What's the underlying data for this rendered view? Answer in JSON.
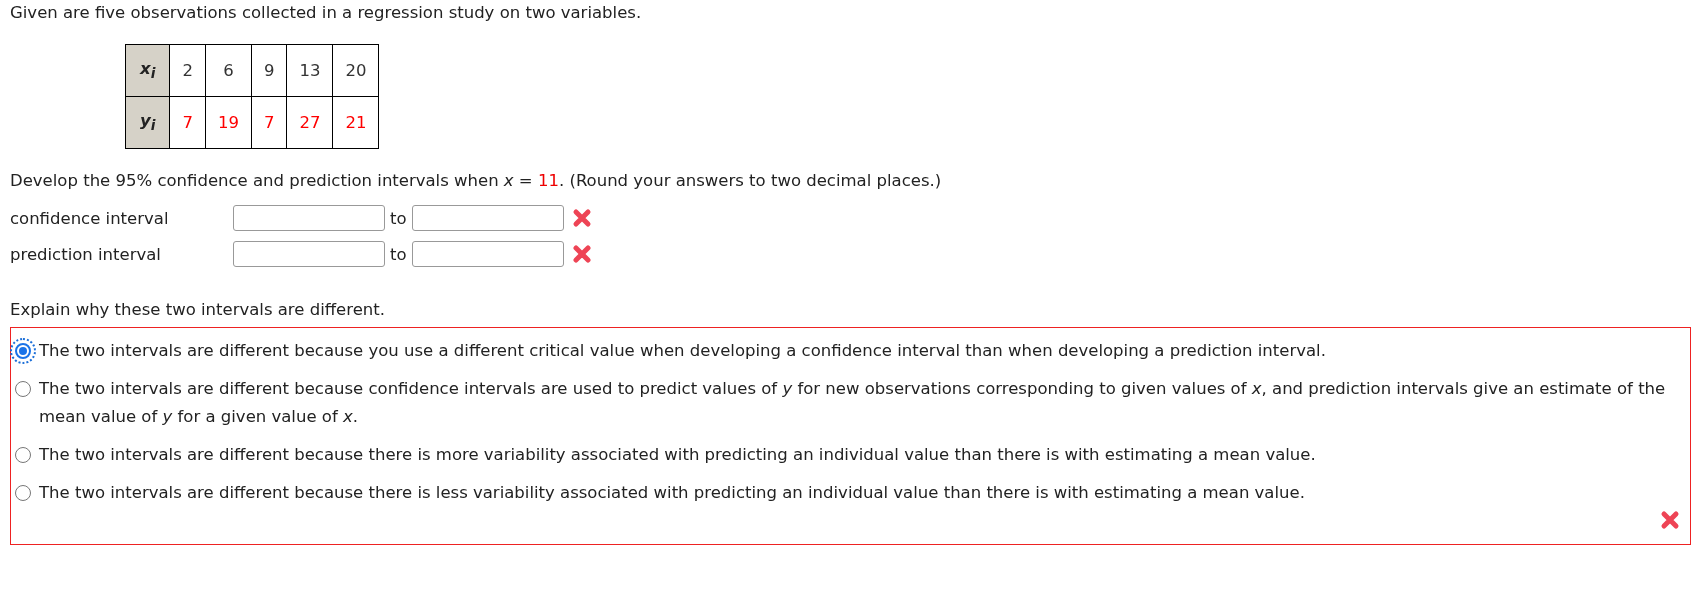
{
  "intro": "Given are five observations collected in a regression study on two variables.",
  "data_table": {
    "rows": [
      {
        "header": "x$_{i}$",
        "color": "#333333",
        "values": [
          "2",
          "6",
          "9",
          "13",
          "20"
        ]
      },
      {
        "header": "y$_{i}$",
        "color": "#ff0000",
        "values": [
          "7",
          "19",
          "7",
          "27",
          "21"
        ]
      }
    ]
  },
  "question": {
    "before": "Develop the 95% confidence and prediction intervals when *x* = ",
    "value": "11",
    "after": ". (Round your answers to two decimal places.)"
  },
  "answer_rows": [
    {
      "label": "confidence interval",
      "separator": "to",
      "correct": false
    },
    {
      "label": "prediction interval",
      "separator": "to",
      "correct": false
    }
  ],
  "explain": {
    "prompt": "Explain why these two intervals are different.",
    "correct": false,
    "options": [
      {
        "text": "The two intervals are different because you use a different critical value when developing a confidence interval than when developing a prediction interval.",
        "selected": true,
        "focused": true
      },
      {
        "text": "The two intervals are different because confidence intervals are used to predict values of *y* for new observations corresponding to given values of *x*, and prediction intervals give an estimate of the mean value of *y* for a given value of *x*.",
        "selected": false,
        "focused": false
      },
      {
        "text": "The two intervals are different because there is more variability associated with predicting an individual value than there is with estimating a mean value.",
        "selected": false,
        "focused": false
      },
      {
        "text": "The two intervals are different because there is less variability associated with predicting an individual value than there is with estimating a mean value.",
        "selected": false,
        "focused": false
      }
    ]
  }
}
